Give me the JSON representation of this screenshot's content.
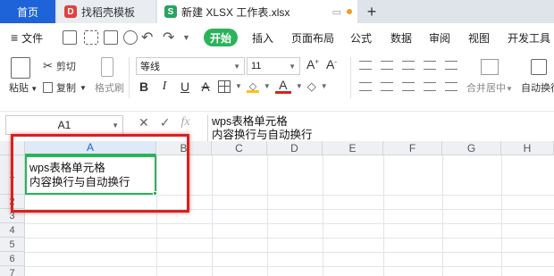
{
  "tabs": {
    "home": "首页",
    "template": "找稻壳模板",
    "file": "新建 XLSX 工作表.xlsx",
    "file_icon": "S"
  },
  "menu": {
    "file": "文件",
    "start": "开始",
    "insert": "插入",
    "page_layout": "页面布局",
    "formulas": "公式",
    "data": "数据",
    "review": "审阅",
    "view": "视图",
    "dev_tools": "开发工具"
  },
  "ribbon": {
    "cut": "剪切",
    "paste": "粘贴",
    "copy": "复制",
    "format_painter": "格式刷",
    "font_name": "等线",
    "font_size": "11",
    "merge_center": "合并居中",
    "auto_wrap": "自动换行"
  },
  "formula_bar": {
    "cell_ref": "A1",
    "line1": "wps表格单元格",
    "line2": "内容换行与自动换行"
  },
  "sheet": {
    "columns": [
      "A",
      "B",
      "C",
      "D",
      "E",
      "F",
      "G",
      "H"
    ],
    "rows": [
      "1",
      "2",
      "3",
      "4",
      "5",
      "6",
      "7"
    ],
    "a1_line1": "wps表格单元格",
    "a1_line2": "内容换行与自动换行"
  },
  "colors": {
    "accent_green": "#2bb35c",
    "tab_blue": "#1e63d8",
    "highlight_red": "#d6221e"
  }
}
